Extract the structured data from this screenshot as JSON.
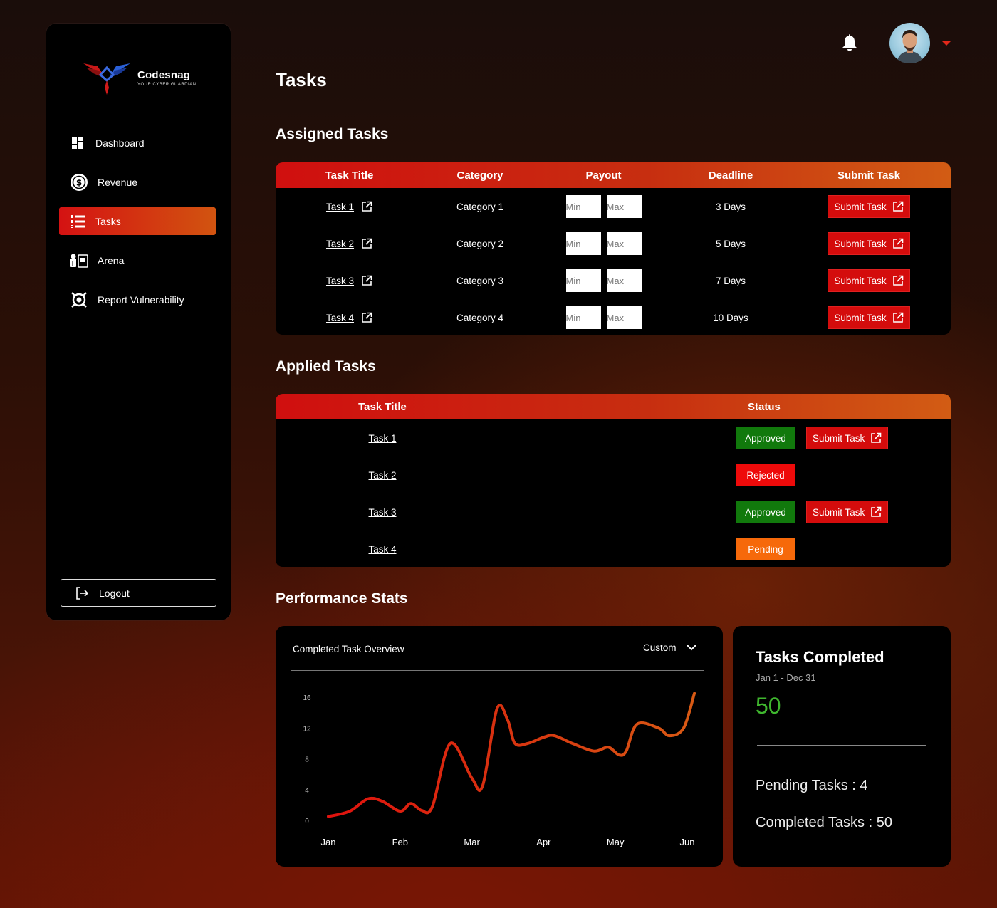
{
  "brand": {
    "name": "Codesnag",
    "tagline": "YOUR CYBER GUARDIAN"
  },
  "sidebar": {
    "items": [
      {
        "label": "Dashboard",
        "icon": "dashboard-icon",
        "active": false
      },
      {
        "label": "Revenue",
        "icon": "dollar-icon",
        "active": false
      },
      {
        "label": "Tasks",
        "icon": "tasks-list-icon",
        "active": true
      },
      {
        "label": "Arena",
        "icon": "arena-icon",
        "active": false
      },
      {
        "label": "Report Vulnerability",
        "icon": "bug-report-icon",
        "active": false
      }
    ],
    "logout_label": "Logout"
  },
  "header": {
    "notification_icon": "bell-icon",
    "avatar_icon": "user-avatar",
    "menu_icon": "caret-down-icon"
  },
  "page": {
    "title": "Tasks"
  },
  "assigned": {
    "title": "Assigned Tasks",
    "columns": [
      "Task Title",
      "Category",
      "Payout",
      "Deadline",
      "Submit Task"
    ],
    "rows": [
      {
        "task": "Task 1",
        "category": "Category 1",
        "min_placeholder": "Min",
        "max_placeholder": "Max",
        "deadline": "3 Days",
        "action": "Submit Task"
      },
      {
        "task": "Task 2",
        "category": "Category 2",
        "min_placeholder": "Min",
        "max_placeholder": "Max",
        "deadline": "5 Days",
        "action": "Submit Task"
      },
      {
        "task": "Task 3",
        "category": "Category 3",
        "min_placeholder": "Min",
        "max_placeholder": "Max",
        "deadline": "7 Days",
        "action": "Submit Task"
      },
      {
        "task": "Task 4",
        "category": "Category 4",
        "min_placeholder": "Min",
        "max_placeholder": "Max",
        "deadline": "10 Days",
        "action": "Submit Task"
      }
    ]
  },
  "applied": {
    "title": "Applied Tasks",
    "columns": [
      "Task Title",
      "Status"
    ],
    "rows": [
      {
        "task": "Task 1",
        "status": "Approved",
        "action": "Submit Task"
      },
      {
        "task": "Task 2",
        "status": "Rejected",
        "action": ""
      },
      {
        "task": "Task 3",
        "status": "Approved",
        "action": "Submit Task"
      },
      {
        "task": "Task 4",
        "status": "Pending",
        "action": ""
      }
    ]
  },
  "performance": {
    "title": "Performance Stats",
    "chart_title": "Completed Task Overview",
    "range_label": "Custom",
    "stats": {
      "title": "Tasks Completed",
      "range": "Jan 1 - Dec 31",
      "value": "50",
      "pending_label": "Pending Tasks : 4",
      "completed_label": "Completed Tasks : 50"
    }
  },
  "colors": {
    "accent_red": "#d40c0c",
    "accent_orange": "#d25c14",
    "approved": "#11790c",
    "rejected": "#ee0a0a",
    "pending": "#f6690a",
    "stat_green": "#3fb62e"
  },
  "chart_data": {
    "type": "line",
    "categories": [
      "Jan",
      "Feb",
      "Mar",
      "Apr",
      "May",
      "Jun"
    ],
    "y_ticks": [
      0,
      4,
      8,
      12,
      16
    ],
    "ylim": [
      0,
      16
    ],
    "grid": false,
    "x": [
      0,
      0.3,
      0.55,
      0.75,
      1.0,
      1.15,
      1.3,
      1.45,
      1.7,
      2.0,
      2.15,
      2.35,
      2.5,
      2.6,
      2.78,
      3.0,
      3.15,
      3.4,
      3.7,
      3.9,
      4.05,
      4.15,
      4.3,
      4.6,
      4.75,
      4.95,
      5.1
    ],
    "values": [
      0.5,
      1.2,
      2.8,
      2.5,
      1.2,
      2.2,
      1.3,
      1.8,
      10,
      5.5,
      4.5,
      14.5,
      13,
      10,
      10,
      10.8,
      11,
      10,
      9,
      9.5,
      8.5,
      9,
      12.5,
      12,
      11,
      12,
      16.5
    ]
  }
}
